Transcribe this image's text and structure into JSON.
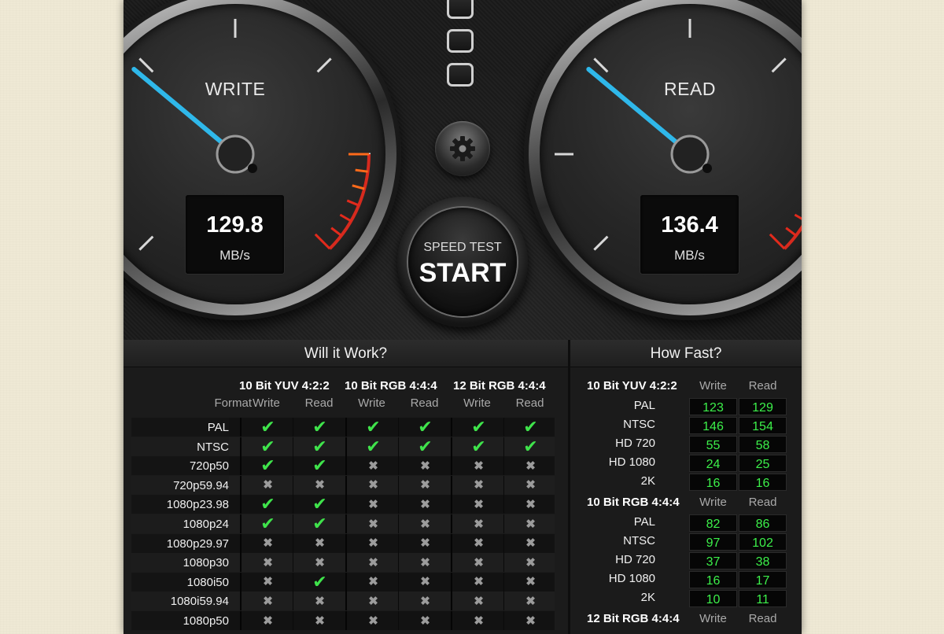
{
  "gauges": {
    "write": {
      "title": "WRITE",
      "value": "129.8",
      "unit": "MB/s",
      "needle_color": "#2fb8ea"
    },
    "read": {
      "title": "READ",
      "value": "136.4",
      "unit": "MB/s",
      "needle_color": "#2fb8ea"
    }
  },
  "controls": {
    "start_small": "SPEED TEST",
    "start_big": "START",
    "settings_icon": "gear-icon",
    "status_lights": 3
  },
  "will_it_work": {
    "title": "Will it Work?",
    "format_label": "Format",
    "groups": [
      "10 Bit YUV 4:2:2",
      "10 Bit RGB 4:4:4",
      "12 Bit RGB 4:4:4"
    ],
    "sub_headers": [
      "Write",
      "Read"
    ],
    "rows": [
      {
        "format": "PAL",
        "cells": [
          1,
          1,
          1,
          1,
          1,
          1
        ]
      },
      {
        "format": "NTSC",
        "cells": [
          1,
          1,
          1,
          1,
          1,
          1
        ]
      },
      {
        "format": "720p50",
        "cells": [
          1,
          1,
          0,
          0,
          0,
          0
        ]
      },
      {
        "format": "720p59.94",
        "cells": [
          0,
          0,
          0,
          0,
          0,
          0
        ]
      },
      {
        "format": "1080p23.98",
        "cells": [
          1,
          1,
          0,
          0,
          0,
          0
        ]
      },
      {
        "format": "1080p24",
        "cells": [
          1,
          1,
          0,
          0,
          0,
          0
        ]
      },
      {
        "format": "1080p29.97",
        "cells": [
          0,
          0,
          0,
          0,
          0,
          0
        ]
      },
      {
        "format": "1080p30",
        "cells": [
          0,
          0,
          0,
          0,
          0,
          0
        ]
      },
      {
        "format": "1080i50",
        "cells": [
          0,
          1,
          0,
          0,
          0,
          0
        ]
      },
      {
        "format": "1080i59.94",
        "cells": [
          0,
          0,
          0,
          0,
          0,
          0
        ]
      },
      {
        "format": "1080p50",
        "cells": [
          0,
          0,
          0,
          0,
          0,
          0
        ]
      }
    ]
  },
  "how_fast": {
    "title": "How Fast?",
    "write_label": "Write",
    "read_label": "Read",
    "sections": [
      {
        "name": "10 Bit YUV 4:2:2",
        "rows": [
          {
            "format": "PAL",
            "write": "123",
            "read": "129"
          },
          {
            "format": "NTSC",
            "write": "146",
            "read": "154"
          },
          {
            "format": "HD 720",
            "write": "55",
            "read": "58"
          },
          {
            "format": "HD 1080",
            "write": "24",
            "read": "25"
          },
          {
            "format": "2K",
            "write": "16",
            "read": "16"
          }
        ]
      },
      {
        "name": "10 Bit RGB 4:4:4",
        "rows": [
          {
            "format": "PAL",
            "write": "82",
            "read": "86"
          },
          {
            "format": "NTSC",
            "write": "97",
            "read": "102"
          },
          {
            "format": "HD 720",
            "write": "37",
            "read": "38"
          },
          {
            "format": "HD 1080",
            "write": "16",
            "read": "17"
          },
          {
            "format": "2K",
            "write": "10",
            "read": "11"
          }
        ]
      },
      {
        "name": "12 Bit RGB 4:4:4",
        "rows": []
      }
    ]
  }
}
